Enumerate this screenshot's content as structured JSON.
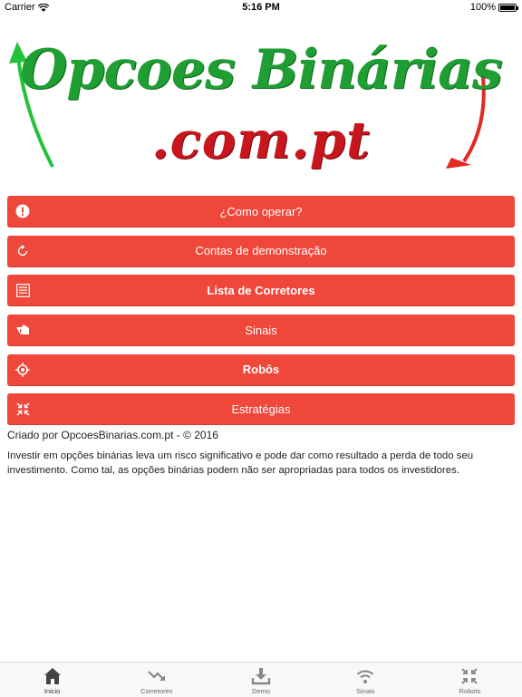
{
  "status_bar": {
    "carrier": "Carrier",
    "time": "5:16 PM",
    "battery": "100%",
    "battery_level": 1.0
  },
  "logo": {
    "line1": "Opcoes Binárias",
    "line2": ".com.pt",
    "colors": {
      "green": "#1f9e33",
      "red": "#c8161d"
    }
  },
  "menu": {
    "accent_color": "#ef473a",
    "items": [
      {
        "label": "¿Como operar?",
        "icon": "alert-circle-icon"
      },
      {
        "label": "Contas de demonstração",
        "icon": "refresh-icon"
      },
      {
        "label": "Lista de Corretores",
        "icon": "list-icon"
      },
      {
        "label": "Sinais",
        "icon": "hand-icon"
      },
      {
        "label": "Robôs",
        "icon": "crosshair-icon"
      },
      {
        "label": "Estratégias",
        "icon": "contract-icon"
      }
    ]
  },
  "footer": {
    "credits": "Criado por OpcoesBinarias.com.pt - © 2016",
    "disclaimer": "Investir em opções binárias leva um risco significativo e pode dar como resultado a perda de todo seu investimento. Como tal, as opções binárias podem não ser apropriadas para todos os investidores."
  },
  "tab_bar": {
    "tabs": [
      {
        "label": "Inicio",
        "icon": "home-icon",
        "active": true
      },
      {
        "label": "Corretores",
        "icon": "trending-down-icon",
        "active": false
      },
      {
        "label": "Demo",
        "icon": "download-icon",
        "active": false
      },
      {
        "label": "Sinais",
        "icon": "wifi-icon",
        "active": false
      },
      {
        "label": "Robots",
        "icon": "contract-icon",
        "active": false
      }
    ]
  }
}
